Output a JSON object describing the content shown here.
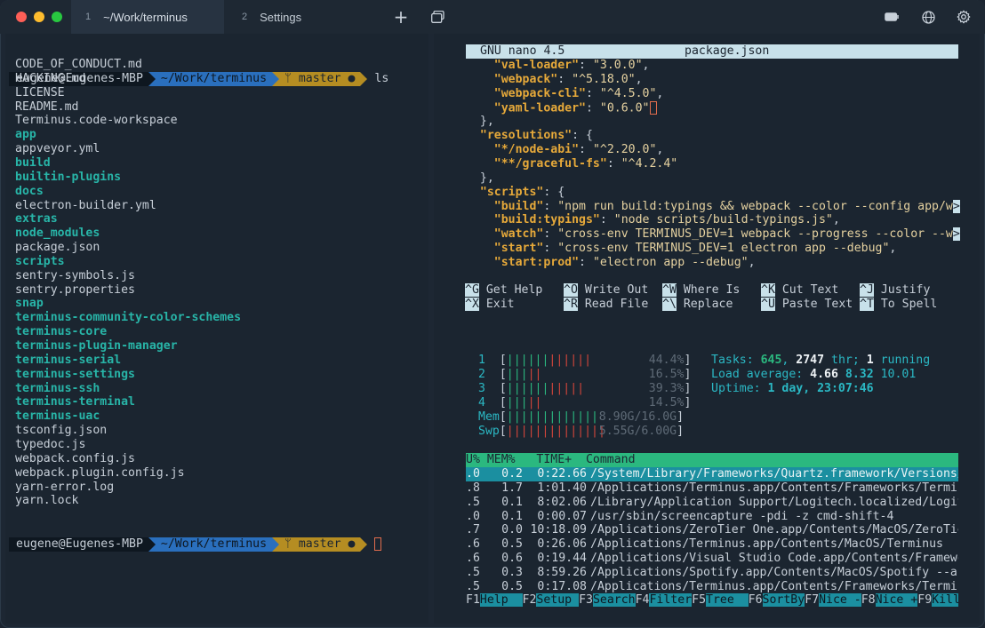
{
  "tabs": [
    {
      "num": "1",
      "label": "~/Work/terminus"
    },
    {
      "num": "2",
      "label": "Settings"
    }
  ],
  "icons": {
    "new_tab": "plus-icon",
    "tab_overview": "windows-icon",
    "battery": "battery-icon",
    "globe": "globe-icon",
    "settings": "gear-icon"
  },
  "left": {
    "prompt": {
      "user": "eugene@Eugenes-MBP",
      "dir": "~/Work/terminus",
      "git": "ᛘ master ●",
      "command": "ls"
    },
    "files": [
      {
        "name": "CODE_OF_CONDUCT.md",
        "dir": false
      },
      {
        "name": "HACKING.md",
        "dir": false
      },
      {
        "name": "LICENSE",
        "dir": false
      },
      {
        "name": "README.md",
        "dir": false
      },
      {
        "name": "Terminus.code-workspace",
        "dir": false
      },
      {
        "name": "app",
        "dir": true
      },
      {
        "name": "appveyor.yml",
        "dir": false
      },
      {
        "name": "build",
        "dir": true
      },
      {
        "name": "builtin-plugins",
        "dir": true
      },
      {
        "name": "docs",
        "dir": true
      },
      {
        "name": "electron-builder.yml",
        "dir": false
      },
      {
        "name": "extras",
        "dir": true
      },
      {
        "name": "node_modules",
        "dir": true
      },
      {
        "name": "package.json",
        "dir": false
      },
      {
        "name": "scripts",
        "dir": true
      },
      {
        "name": "sentry-symbols.js",
        "dir": false
      },
      {
        "name": "sentry.properties",
        "dir": false
      },
      {
        "name": "snap",
        "dir": true
      },
      {
        "name": "terminus-community-color-schemes",
        "dir": true
      },
      {
        "name": "terminus-core",
        "dir": true
      },
      {
        "name": "terminus-plugin-manager",
        "dir": true
      },
      {
        "name": "terminus-serial",
        "dir": true
      },
      {
        "name": "terminus-settings",
        "dir": true
      },
      {
        "name": "terminus-ssh",
        "dir": true
      },
      {
        "name": "terminus-terminal",
        "dir": true
      },
      {
        "name": "terminus-uac",
        "dir": true
      },
      {
        "name": "tsconfig.json",
        "dir": false
      },
      {
        "name": "typedoc.js",
        "dir": false
      },
      {
        "name": "webpack.config.js",
        "dir": false
      },
      {
        "name": "webpack.plugin.config.js",
        "dir": false
      },
      {
        "name": "yarn-error.log",
        "dir": false
      },
      {
        "name": "yarn.lock",
        "dir": false
      }
    ]
  },
  "nano": {
    "version": "GNU nano 4.5",
    "filename": "package.json",
    "lines": [
      [
        {
          "t": "    ",
          "c": "punc"
        },
        {
          "t": "\"val-loader\"",
          "c": "key"
        },
        {
          "t": ": ",
          "c": "punc"
        },
        {
          "t": "\"3.0.0\"",
          "c": "str"
        },
        {
          "t": ",",
          "c": "punc"
        }
      ],
      [
        {
          "t": "    ",
          "c": "punc"
        },
        {
          "t": "\"webpack\"",
          "c": "key"
        },
        {
          "t": ": ",
          "c": "punc"
        },
        {
          "t": "\"^5.18.0\"",
          "c": "str"
        },
        {
          "t": ",",
          "c": "punc"
        }
      ],
      [
        {
          "t": "    ",
          "c": "punc"
        },
        {
          "t": "\"webpack-cli\"",
          "c": "key"
        },
        {
          "t": ": ",
          "c": "punc"
        },
        {
          "t": "\"^4.5.0\"",
          "c": "str"
        },
        {
          "t": ",",
          "c": "punc"
        }
      ],
      [
        {
          "t": "    ",
          "c": "punc"
        },
        {
          "t": "\"yaml-loader\"",
          "c": "key"
        },
        {
          "t": ": ",
          "c": "punc"
        },
        {
          "t": "\"0.6.0\"",
          "c": "str"
        }
      ],
      [
        {
          "t": "  },",
          "c": "punc"
        }
      ],
      [
        {
          "t": "  ",
          "c": "punc"
        },
        {
          "t": "\"resolutions\"",
          "c": "key"
        },
        {
          "t": ": {",
          "c": "punc"
        }
      ],
      [
        {
          "t": "    ",
          "c": "punc"
        },
        {
          "t": "\"*/node-abi\"",
          "c": "key"
        },
        {
          "t": ": ",
          "c": "punc"
        },
        {
          "t": "\"^2.20.0\"",
          "c": "str"
        },
        {
          "t": ",",
          "c": "punc"
        }
      ],
      [
        {
          "t": "    ",
          "c": "punc"
        },
        {
          "t": "\"**/graceful-fs\"",
          "c": "key"
        },
        {
          "t": ": ",
          "c": "punc"
        },
        {
          "t": "\"^4.2.4\"",
          "c": "str"
        }
      ],
      [
        {
          "t": "  },",
          "c": "punc"
        }
      ],
      [
        {
          "t": "  ",
          "c": "punc"
        },
        {
          "t": "\"scripts\"",
          "c": "key"
        },
        {
          "t": ": {",
          "c": "punc"
        }
      ],
      [
        {
          "t": "    ",
          "c": "punc"
        },
        {
          "t": "\"build\"",
          "c": "key"
        },
        {
          "t": ": ",
          "c": "punc"
        },
        {
          "t": "\"npm run build:typings && webpack --color --config app/w",
          "c": "str"
        },
        {
          "t": ">",
          "c": "nk"
        }
      ],
      [
        {
          "t": "    ",
          "c": "punc"
        },
        {
          "t": "\"build:typings\"",
          "c": "key"
        },
        {
          "t": ": ",
          "c": "punc"
        },
        {
          "t": "\"node scripts/build-typings.js\"",
          "c": "str"
        },
        {
          "t": ",",
          "c": "punc"
        }
      ],
      [
        {
          "t": "    ",
          "c": "punc"
        },
        {
          "t": "\"watch\"",
          "c": "key"
        },
        {
          "t": ": ",
          "c": "punc"
        },
        {
          "t": "\"cross-env TERMINUS_DEV=1 webpack --progress --color --w",
          "c": "str"
        },
        {
          "t": ">",
          "c": "nk"
        }
      ],
      [
        {
          "t": "    ",
          "c": "punc"
        },
        {
          "t": "\"start\"",
          "c": "key"
        },
        {
          "t": ": ",
          "c": "punc"
        },
        {
          "t": "\"cross-env TERMINUS_DEV=1 electron app --debug\"",
          "c": "str"
        },
        {
          "t": ",",
          "c": "punc"
        }
      ],
      [
        {
          "t": "    ",
          "c": "punc"
        },
        {
          "t": "\"start:prod\"",
          "c": "key"
        },
        {
          "t": ": ",
          "c": "punc"
        },
        {
          "t": "\"electron app --debug\"",
          "c": "str"
        },
        {
          "t": ",",
          "c": "punc"
        }
      ]
    ],
    "shortcuts": [
      [
        {
          "k": "^G",
          "l": "Get Help"
        },
        {
          "k": "^O",
          "l": "Write Out"
        },
        {
          "k": "^W",
          "l": "Where Is"
        },
        {
          "k": "^K",
          "l": "Cut Text"
        },
        {
          "k": "^J",
          "l": "Justify"
        }
      ],
      [
        {
          "k": "^X",
          "l": "Exit"
        },
        {
          "k": "^R",
          "l": "Read File"
        },
        {
          "k": "^\\",
          "l": "Replace"
        },
        {
          "k": "^U",
          "l": "Paste Text"
        },
        {
          "k": "^T",
          "l": "To Spell"
        }
      ]
    ]
  },
  "htop": {
    "cpus": [
      {
        "id": "1",
        "bars": "||||||||||||",
        "pct": "44.4%",
        "pct_value": 44.4
      },
      {
        "id": "2",
        "bars": "|||||",
        "pct": "16.5%",
        "pct_value": 16.5
      },
      {
        "id": "3",
        "bars": "|||||||||||",
        "pct": "39.3%",
        "pct_value": 39.3
      },
      {
        "id": "4",
        "bars": "|||||",
        "pct": "14.5%",
        "pct_value": 14.5
      }
    ],
    "mem": {
      "label": "Mem",
      "bars": "|||||||||||||",
      "value": "8.90G/16.0G"
    },
    "swp": {
      "label": "Swp",
      "bars": "||||||||||||||",
      "value": "5.55G/6.00G"
    },
    "tasks": {
      "label": "Tasks: ",
      "count": "645",
      "sep": ", ",
      "thr": "2747",
      "thr_label": " thr; ",
      "running": "1",
      "running_label": " running"
    },
    "load": {
      "label": "Load average: ",
      "v1": "4.66",
      "v2": "8.32",
      "v3": "10.01"
    },
    "uptime": {
      "label": "Uptime: ",
      "value": "1 day, 23:07:46"
    },
    "header": "U% MEM%   TIME+  Command",
    "rows": [
      {
        "cpu": ".0",
        "mem": "0.2",
        "time": "0:22.66",
        "cmd": "/System/Library/Frameworks/Quartz.framework/Versions/"
      },
      {
        "cpu": ".8",
        "mem": "1.7",
        "time": "1:01.40",
        "cmd": "/Applications/Terminus.app/Contents/Frameworks/Termin"
      },
      {
        "cpu": ".5",
        "mem": "0.1",
        "time": "8:02.06",
        "cmd": "/Library/Application Support/Logitech.localized/Logit"
      },
      {
        "cpu": ".0",
        "mem": "0.1",
        "time": "0:00.07",
        "cmd": "/usr/sbin/screencapture -pdi -z cmd-shift-4"
      },
      {
        "cpu": ".7",
        "mem": "0.0",
        "time": "10:18.09",
        "cmd": "/Applications/ZeroTier One.app/Contents/MacOS/ZeroTie"
      },
      {
        "cpu": ".6",
        "mem": "0.5",
        "time": "0:26.06",
        "cmd": "/Applications/Terminus.app/Contents/MacOS/Terminus"
      },
      {
        "cpu": ".6",
        "mem": "0.6",
        "time": "0:19.44",
        "cmd": "/Applications/Visual Studio Code.app/Contents/Framewo"
      },
      {
        "cpu": ".5",
        "mem": "0.3",
        "time": "8:59.26",
        "cmd": "/Applications/Spotify.app/Contents/MacOS/Spotify --au"
      },
      {
        "cpu": ".5",
        "mem": "0.5",
        "time": "0:17.08",
        "cmd": "/Applications/Terminus.app/Contents/Frameworks/Termin"
      }
    ],
    "fkeys": [
      {
        "k": "F1",
        "l": "Help  "
      },
      {
        "k": "F2",
        "l": "Setup "
      },
      {
        "k": "F3",
        "l": "Search"
      },
      {
        "k": "F4",
        "l": "Filter"
      },
      {
        "k": "F5",
        "l": "Tree  "
      },
      {
        "k": "F6",
        "l": "SortBy"
      },
      {
        "k": "F7",
        "l": "Nice -"
      },
      {
        "k": "F8",
        "l": "Nice +"
      },
      {
        "k": "F9",
        "l": "Kill"
      }
    ]
  }
}
